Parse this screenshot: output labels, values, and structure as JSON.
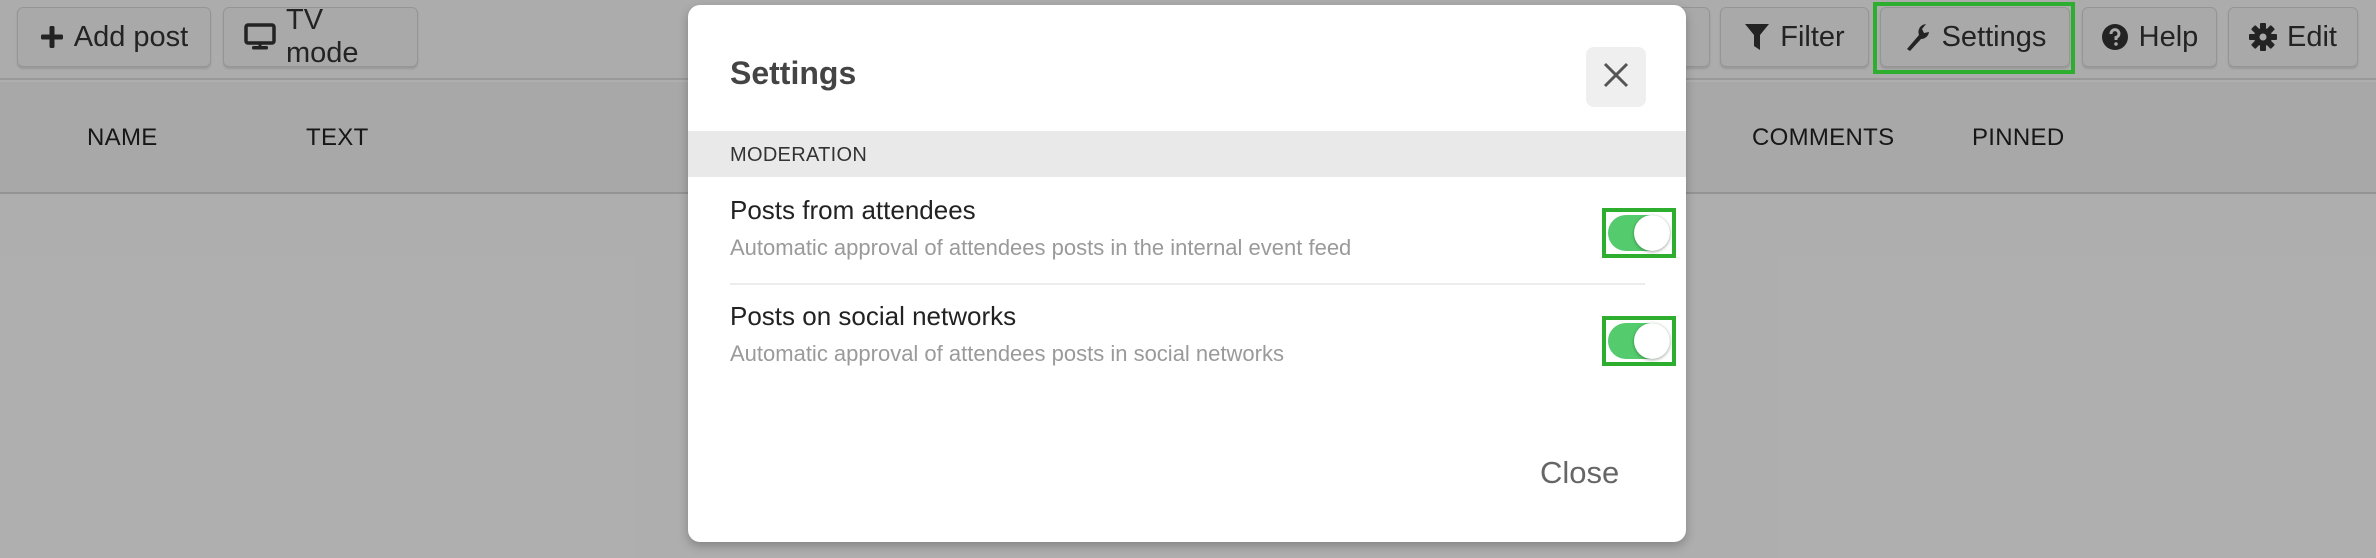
{
  "toolbar": {
    "buttons": [
      {
        "label": "Add post",
        "icon": "plus-icon"
      },
      {
        "label": "TV mode",
        "icon": "monitor-icon"
      },
      {
        "label": "Filter",
        "icon": "filter-icon"
      },
      {
        "label": "Settings",
        "icon": "wrench-icon",
        "highlighted": true
      },
      {
        "label": "Help",
        "icon": "question-circle-icon"
      },
      {
        "label": "Edit",
        "icon": "gear-icon"
      }
    ]
  },
  "table": {
    "columns": [
      "NAME",
      "TEXT",
      "COMMENTS",
      "PINNED"
    ]
  },
  "modal": {
    "title": "Settings",
    "section": "MODERATION",
    "settings": [
      {
        "title": "Posts from attendees",
        "description": "Automatic approval of attendees posts in the internal event feed",
        "enabled": true
      },
      {
        "title": "Posts on social networks",
        "description": "Automatic approval of attendees posts in social networks",
        "enabled": true
      }
    ],
    "close_label": "Close"
  },
  "colors": {
    "toggle_on": "#54cb6c",
    "highlight": "#2eae2e"
  }
}
